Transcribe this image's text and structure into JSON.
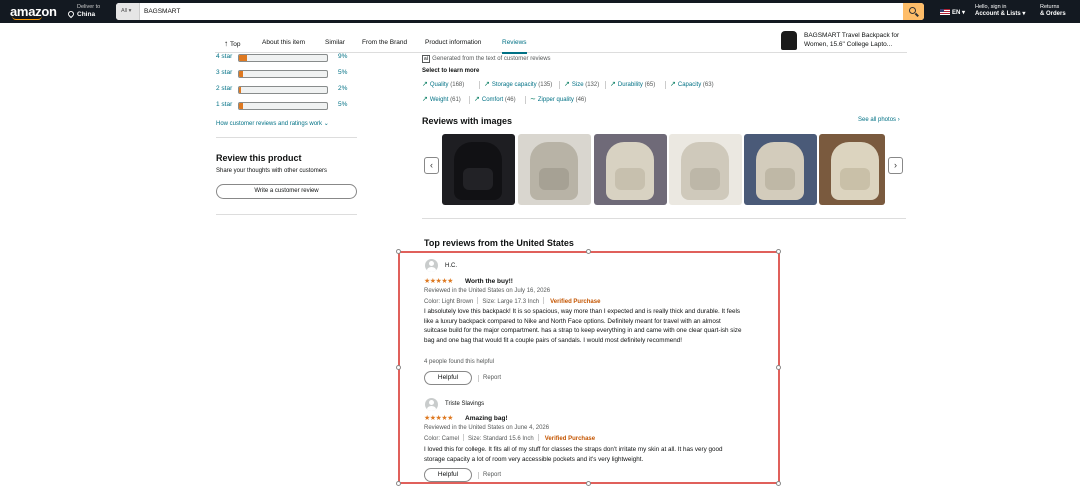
{
  "nav": {
    "logo": "amazon",
    "deliver_line1": "Deliver to",
    "deliver_line2": "China",
    "search_category": "All",
    "search_value": "BAGSMART",
    "language": "EN",
    "account_line1": "Hello, sign in",
    "account_line2": "Account & Lists",
    "orders_line1": "Returns",
    "orders_line2": "& Orders"
  },
  "subnav": {
    "tabs": [
      "Top",
      "About this item",
      "Similar",
      "From the Brand",
      "Product information",
      "Reviews"
    ],
    "active_tab": "Reviews",
    "product_title": "BAGSMART Travel Backpack for Women, 15.6\" College Lapto..."
  },
  "ratings": [
    {
      "label": "4 star",
      "percent": "9%",
      "fill": 9
    },
    {
      "label": "3 star",
      "percent": "5%",
      "fill": 5
    },
    {
      "label": "2 star",
      "percent": "2%",
      "fill": 2
    },
    {
      "label": "1 star",
      "percent": "5%",
      "fill": 5
    }
  ],
  "how_link": "How customer reviews and ratings work",
  "review_product": {
    "title": "Review this product",
    "subtitle": "Share your thoughts with other customers",
    "button": "Write a customer review"
  },
  "summary": {
    "generated": "Generated from the text of customer reviews",
    "ai_badge": "ai",
    "select_label": "Select to learn more",
    "aspects": [
      {
        "name": "Quality",
        "count": "(168)",
        "icon": "trend-up-icon"
      },
      {
        "name": "Storage capacity",
        "count": "(135)",
        "icon": "trend-up-icon"
      },
      {
        "name": "Size",
        "count": "(132)",
        "icon": "trend-up-icon"
      },
      {
        "name": "Durability",
        "count": "(65)",
        "icon": "trend-up-icon"
      },
      {
        "name": "Capacity",
        "count": "(63)",
        "icon": "trend-up-icon"
      },
      {
        "name": "Weight",
        "count": "(61)",
        "icon": "trend-up-icon"
      },
      {
        "name": "Comfort",
        "count": "(46)",
        "icon": "trend-up-icon"
      },
      {
        "name": "Zipper quality",
        "count": "(46)",
        "icon": "trend-mixed-icon"
      }
    ]
  },
  "reviews_with_images": {
    "title": "Reviews with images",
    "see_all": "See all photos ›",
    "images": [
      {
        "bg": "#1e1e22",
        "bag": "#111114",
        "pocket": "#222226"
      },
      {
        "bg": "#d9d6cf",
        "bag": "#b8b3a6",
        "pocket": "#a6a194"
      },
      {
        "bg": "#6f6a78",
        "bag": "#d8d2c2",
        "pocket": "#c7c0ae"
      },
      {
        "bg": "#ebe8e1",
        "bag": "#cfc9bb",
        "pocket": "#bdb7a8"
      },
      {
        "bg": "#4a5a78",
        "bag": "#d3ccbc",
        "pocket": "#bfb8a6"
      },
      {
        "bg": "#7a5a3e",
        "bag": "#dcd4bf",
        "pocket": "#c9c0a8"
      }
    ]
  },
  "top_reviews": {
    "title": "Top reviews from the United States",
    "helpful_label": "Helpful",
    "report_label": "Report",
    "items": [
      {
        "name": "H.C.",
        "stars": "★★★★★",
        "title": "Worth the buy!!",
        "date": "Reviewed in the United States on July 16, 2026",
        "color": "Color: Light Brown",
        "size": "Size: Large 17.3 Inch",
        "verified": "Verified Purchase",
        "body": "I absolutely love this backpack! It is so spacious, way more than I expected and is really thick and durable. It feels like a luxury backpack compared to Nike and North Face options. Definitely meant for travel with an almost suitcase build for the major compartment. has a strap to keep everything in and came with one clear quart-ish size bag and one bag that would fit a couple pairs of sandals. I would most definitely recommend!",
        "helpful_note": "4 people found this helpful"
      },
      {
        "name": "Triste Slavings",
        "stars": "★★★★★",
        "title": "Amazing bag!",
        "date": "Reviewed in the United States on June 4, 2026",
        "color": "Color: Camel",
        "size": "Size: Standard 15.6 Inch",
        "verified": "Verified Purchase",
        "body": "I loved this for college. It fits all of my stuff for classes the straps don't irritate my skin at all. It has very good storage capacity a lot of room very accessible pockets and it's very lightweight.",
        "helpful_note": ""
      }
    ]
  }
}
